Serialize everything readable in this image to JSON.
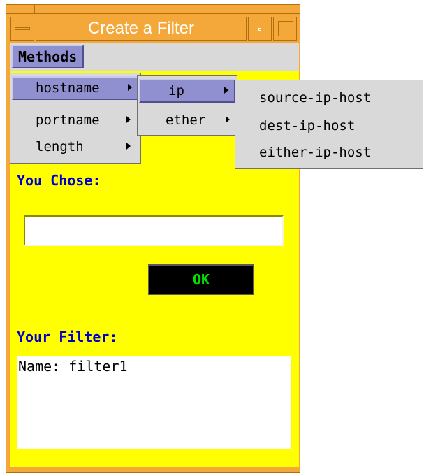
{
  "window": {
    "title": "Create a Filter"
  },
  "menubar": {
    "methods_label": "Methods"
  },
  "menus": {
    "level1": [
      {
        "label": "hostname",
        "selected": true
      },
      {
        "label": "portname",
        "selected": false
      },
      {
        "label": "length",
        "selected": false
      }
    ],
    "level2": [
      {
        "label": "ip",
        "selected": true
      },
      {
        "label": "ether",
        "selected": false
      }
    ],
    "level3": [
      {
        "label": "source-ip-host"
      },
      {
        "label": "dest-ip-host"
      },
      {
        "label": "either-ip-host"
      }
    ]
  },
  "form": {
    "you_chose_label": "You Chose:",
    "chosen_value": "",
    "ok_label": "OK",
    "your_filter_label": "Your Filter:",
    "filter_text": "Name: filter1"
  },
  "colors": {
    "frame": "#f4a83a",
    "client_bg": "#ffff00",
    "highlight": "#9090d0",
    "label_blue": "#0000cc",
    "ok_text": "#00e000"
  },
  "icons": {
    "window_menu": "window-menu-icon",
    "minimize": "minimize-icon",
    "maximize": "maximize-icon",
    "submenu_arrow": "submenu-arrow-icon"
  }
}
